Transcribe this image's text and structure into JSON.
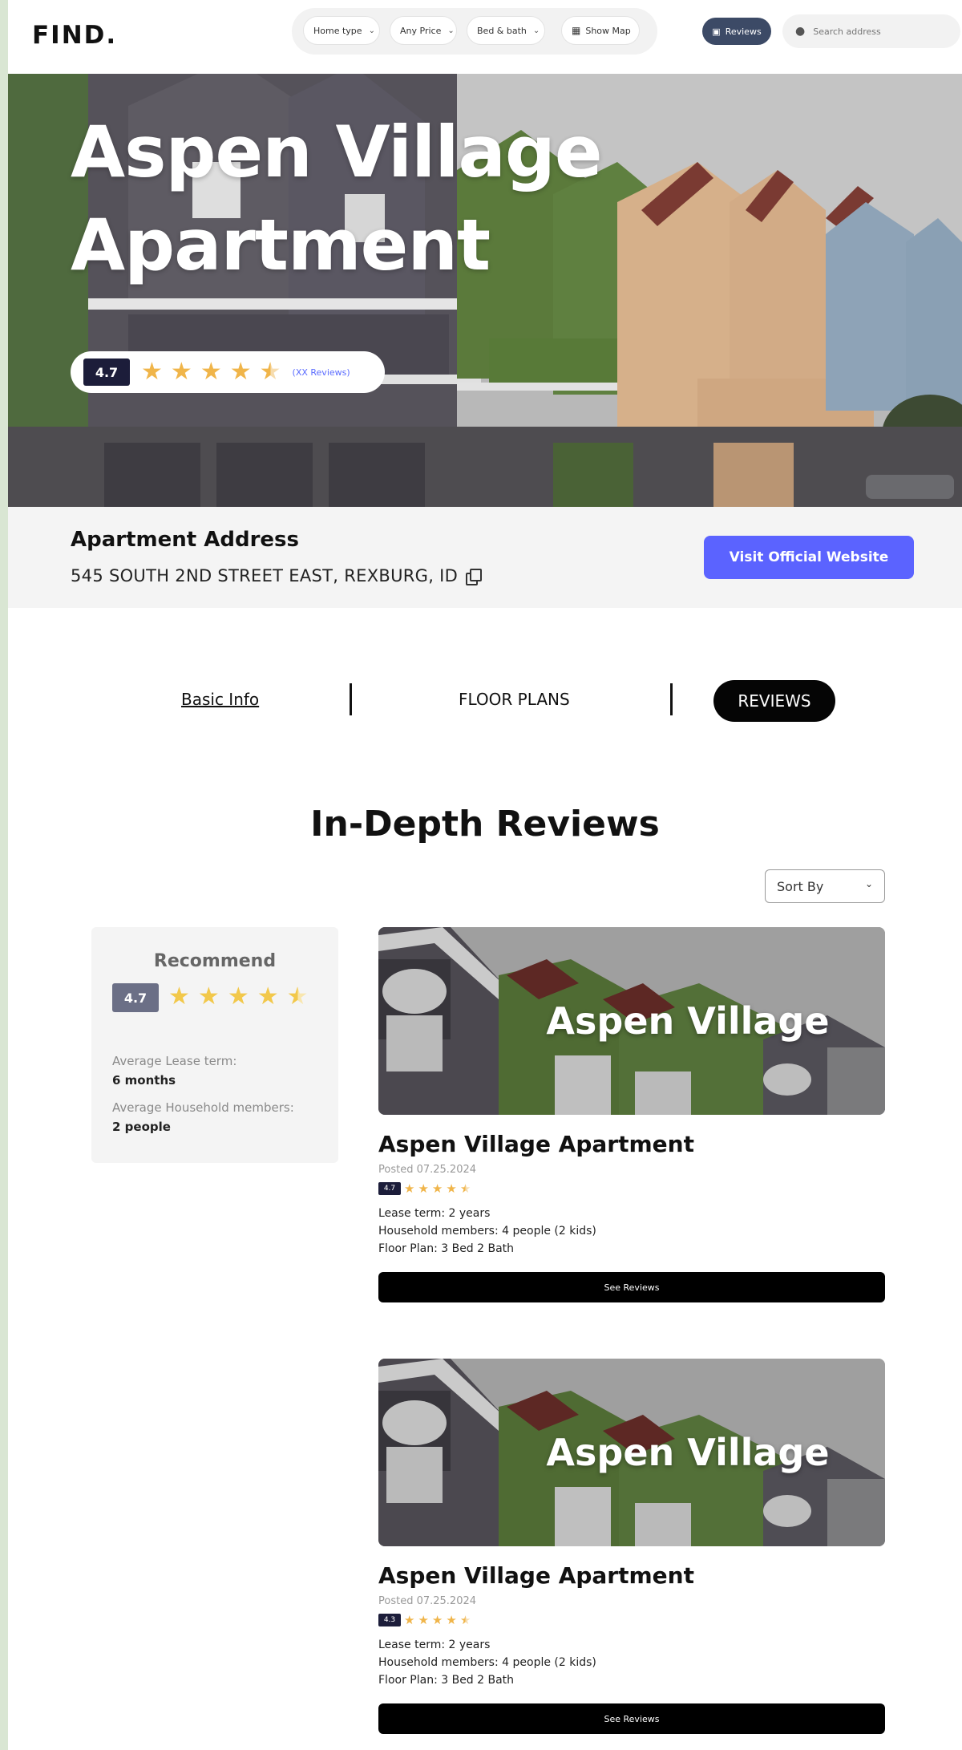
{
  "header": {
    "logo": "FIND.",
    "filters": [
      {
        "label": "Home type"
      },
      {
        "label": "Any Price"
      },
      {
        "label": "Bed & bath"
      }
    ],
    "show_map_label": "Show Map",
    "reviews_label": "Reviews",
    "search_placeholder": "Search address"
  },
  "hero": {
    "title": "Aspen Village Apartment",
    "score": "4.7",
    "star_rating": 4.5,
    "reviews_count": "(XX Reviews)"
  },
  "address": {
    "label": "Apartment Address",
    "value": "545 SOUTH 2ND STREET EAST, REXBURG, ID",
    "visit_label": "Visit Official Website"
  },
  "tabs": [
    {
      "label": "Basic Info"
    },
    {
      "label": "FLOOR PLANS"
    },
    {
      "label": "REVIEWS",
      "active": true
    }
  ],
  "section": {
    "title": "In-Depth Reviews",
    "sort_label": "Sort By"
  },
  "recommend": {
    "title": "Recommend",
    "score": "4.7",
    "star_rating": 4.5,
    "lease_label": "Average Lease term:",
    "lease_value": "6 months",
    "household_label": "Average Household members:",
    "household_value": "2 people"
  },
  "reviews": [
    {
      "image_text": "Aspen Village",
      "title": "Aspen Village Apartment",
      "date": "Posted 07.25.2024",
      "score": "4.7",
      "star_rating": 4.5,
      "lease": "Lease term: 2 years",
      "household": "Household members: 4 people (2 kids)",
      "floor_plan": "Floor Plan: 3 Bed 2 Bath",
      "button": "See Reviews"
    },
    {
      "image_text": "Aspen Village",
      "title": "Aspen Village Apartment",
      "date": "Posted 07.25.2024",
      "score": "4.3",
      "star_rating": 4.5,
      "lease": "Lease term: 2 years",
      "household": "Household members: 4 people (2 kids)",
      "floor_plan": "Floor Plan: 3 Bed 2 Bath",
      "button": "See Reviews"
    }
  ],
  "colors": {
    "accent": "#5b63ff",
    "star": "#f0b54a",
    "dark_badge": "#1c1d3a",
    "reviews_button": "#3c4a66"
  }
}
